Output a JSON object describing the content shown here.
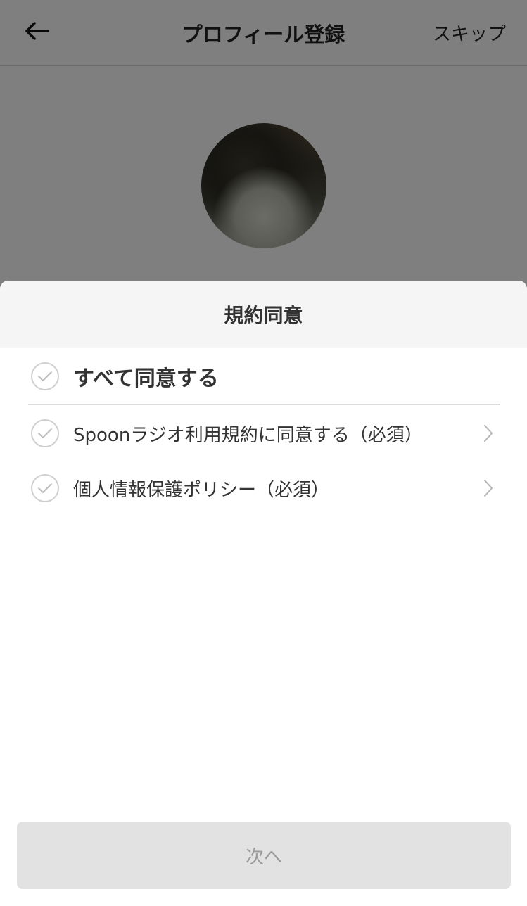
{
  "header": {
    "title": "プロフィール登録",
    "skip_label": "スキップ"
  },
  "sheet": {
    "title": "規約同意",
    "agree_all_label": "すべて同意する",
    "items": [
      {
        "label": "Spoonラジオ利用規約に同意する（必須）"
      },
      {
        "label": "個人情報保護ポリシー（必須）"
      }
    ],
    "next_label": "次へ"
  },
  "icons": {
    "back": "arrow-left-icon",
    "check": "check-circle-icon",
    "chevron": "chevron-right-icon"
  }
}
